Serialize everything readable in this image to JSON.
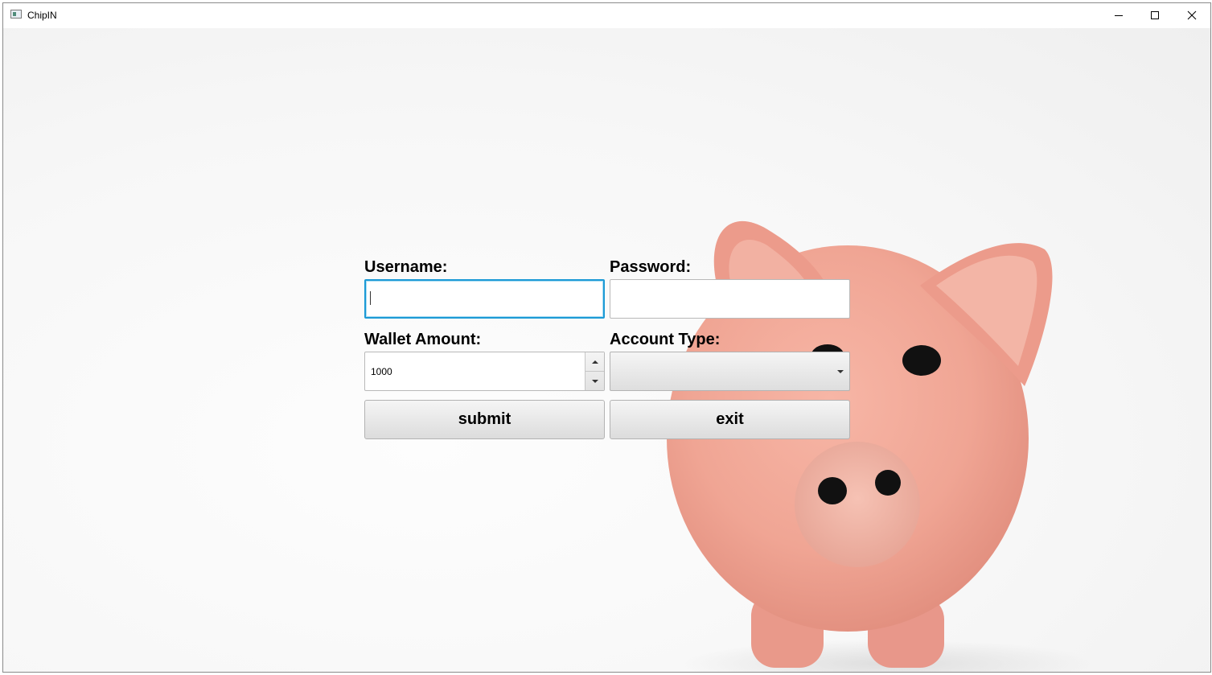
{
  "window": {
    "title": "ChipIN",
    "icon": "app-window-icon",
    "controls": [
      "minimize-icon",
      "maximize-icon",
      "close-icon"
    ]
  },
  "form": {
    "username_label": "Username:",
    "username_value": "",
    "password_label": "Password:",
    "password_value": "",
    "wallet_label": "Wallet Amount:",
    "wallet_value": "1000",
    "account_type_label": "Account Type:",
    "account_type_value": "",
    "submit_label": "submit",
    "exit_label": "exit"
  },
  "background": {
    "image": "piggy-bank",
    "pig_color": "#f0a898"
  },
  "colors": {
    "focus_border": "#1c9ad6"
  }
}
